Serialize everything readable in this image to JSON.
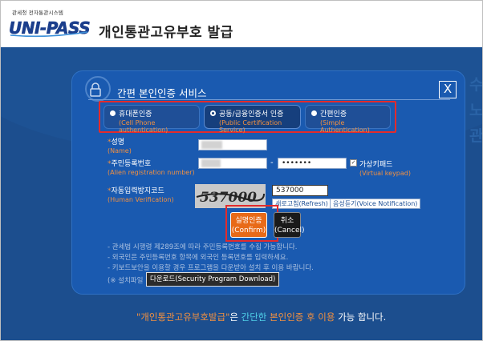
{
  "header": {
    "small_text": "관세청 전자통관시스템",
    "logo_text": "UNI-PASS",
    "title": "개인통관고유부호 발급"
  },
  "dialog": {
    "title": "간편 본인인증 서비스",
    "close_label": "X",
    "methods": [
      {
        "label": "휴대폰인증",
        "sub": "(Cell Phone authentication)"
      },
      {
        "label": "공동/금융인증서 인증",
        "sub": "(Public Certification Service)"
      },
      {
        "label": "간편인증",
        "sub": "(Simple Authentication)"
      }
    ],
    "selected_method": "공동/금융인증서 인증",
    "fields": {
      "name": {
        "label": "성명",
        "en": "(Name)"
      },
      "alien": {
        "label": "주민등록번호",
        "en": "(Alien registration number)",
        "second_value": "•••••••",
        "separator": "-"
      },
      "virtual_keypad": {
        "label": "가상키패드",
        "en": "(Virtual keypad)",
        "checked": true
      },
      "captcha": {
        "label": "자동입력방지코드",
        "en": "(Human Verification)",
        "image_text": "537000",
        "value": "537000"
      }
    },
    "refresh_label": "새로고침(Refresh)",
    "voice_label": "음성듣기(Voice Notification)",
    "confirm_label_ko": "실명인증",
    "confirm_label_en": "(Confirm)",
    "cancel_label_ko": "취소",
    "cancel_label_en": "(Cancel)",
    "notes": [
      "- 관세법 시행령 제289조에 따라 주민등록번호를 수집 가능합니다.",
      "- 외국인은 주민등록번호 항목에 외국인 등록번호를 입력하세요.",
      "- 키보드보안을 이용할 경우 프로그램을 다운받아 설치 후 이용 바랍니다."
    ],
    "install_prefix": "(※ 설치파일",
    "download_label": "다운로드(Security Program Download)"
  },
  "footer": {
    "part1": "\"개인통관고유부호발급\"",
    "part2": "은 ",
    "part3": "간단한",
    "part4": " 본인인증 후 이용",
    "part5": " 가능 합니다."
  },
  "colors": {
    "background": "#1c4e8e",
    "dialog": "#1a5ab0",
    "accent_orange": "#e86a18",
    "highlight_red": "#e42b2b"
  }
}
